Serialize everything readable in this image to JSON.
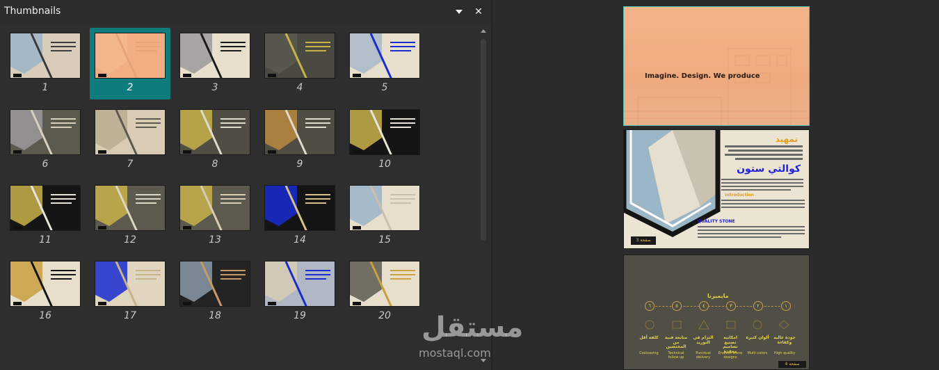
{
  "pane": {
    "title": "Thumbnails",
    "menu_icon": "triangle-down-icon",
    "close_icon": "close-icon",
    "close_glyph": "✕"
  },
  "thumbnails": [
    {
      "number": "1"
    },
    {
      "number": "2",
      "selected": true
    },
    {
      "number": "3"
    },
    {
      "number": "4"
    },
    {
      "number": "5"
    },
    {
      "number": "6"
    },
    {
      "number": "7"
    },
    {
      "number": "8"
    },
    {
      "number": "9"
    },
    {
      "number": "10"
    },
    {
      "number": "11"
    },
    {
      "number": "12"
    },
    {
      "number": "13"
    },
    {
      "number": "14"
    },
    {
      "number": "15"
    },
    {
      "number": "16"
    },
    {
      "number": "17"
    },
    {
      "number": "18"
    },
    {
      "number": "19"
    },
    {
      "number": "20"
    }
  ],
  "preview": {
    "slide_a_text": "Imagine. Design. We produce",
    "slide_b": {
      "heading_ar": "تمهيد",
      "title_ar": "كوالتي ستون",
      "intro_label": "Introduction",
      "quality_label": "QUALITY STONE",
      "page_label": "صفحة 3"
    },
    "slide_c": {
      "title_ar": "مايميزنا",
      "steps": [
        "٦",
        "٥",
        "٤",
        "٣",
        "٢",
        "١"
      ],
      "labels_ar": [
        "كلفة أقل",
        "متابعة فنية من المختصين",
        "التزام في التوريد",
        "امكانية تصنيع تصاميم معقدة",
        "ألوان كثيرة",
        "جودة عالية وكفاءة"
      ],
      "labels_en": [
        "Costsaving",
        "Technical follow up",
        "Punctual delivery",
        "Endless stone designs",
        "Multi colors",
        "High quality"
      ],
      "page_label": "صفحة 4"
    }
  },
  "watermark": {
    "logo": "مستقل",
    "text": "mostaql.com"
  },
  "colors": {
    "selected": "#0e7c7d",
    "accent_border": "#47c2b9"
  }
}
